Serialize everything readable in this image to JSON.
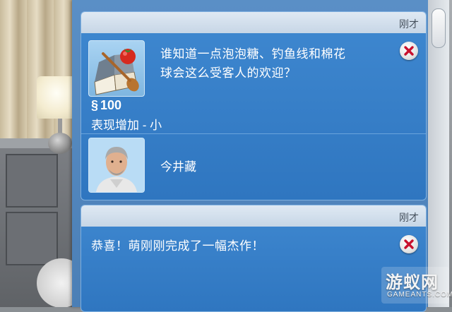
{
  "notifications": [
    {
      "time": "刚才",
      "message": "谁知道一点泡泡糖、钓鱼线和棉花球会这么受客人的欢迎？",
      "message_line1": "谁知道一点泡泡糖、钓鱼线和棉花",
      "message_line2": "球会这么受客人的欢迎？",
      "item_icon": "cookbook-tomato-spoon-icon",
      "reward_symbol": "§",
      "reward_amount": "100",
      "effect": "表现增加 - 小",
      "sim_name": "今井藏",
      "sim_portrait": "elderly-man-portrait"
    },
    {
      "time": "刚才",
      "message": "恭喜！萌刚刚完成了一幅杰作！"
    }
  ],
  "watermark": {
    "title": "游蚁网",
    "subtitle": "GAMEANTS.COM"
  },
  "colors": {
    "card_blue": "#2f76c0",
    "header_gray": "#d3dfeb",
    "close_red": "#c8102e"
  }
}
